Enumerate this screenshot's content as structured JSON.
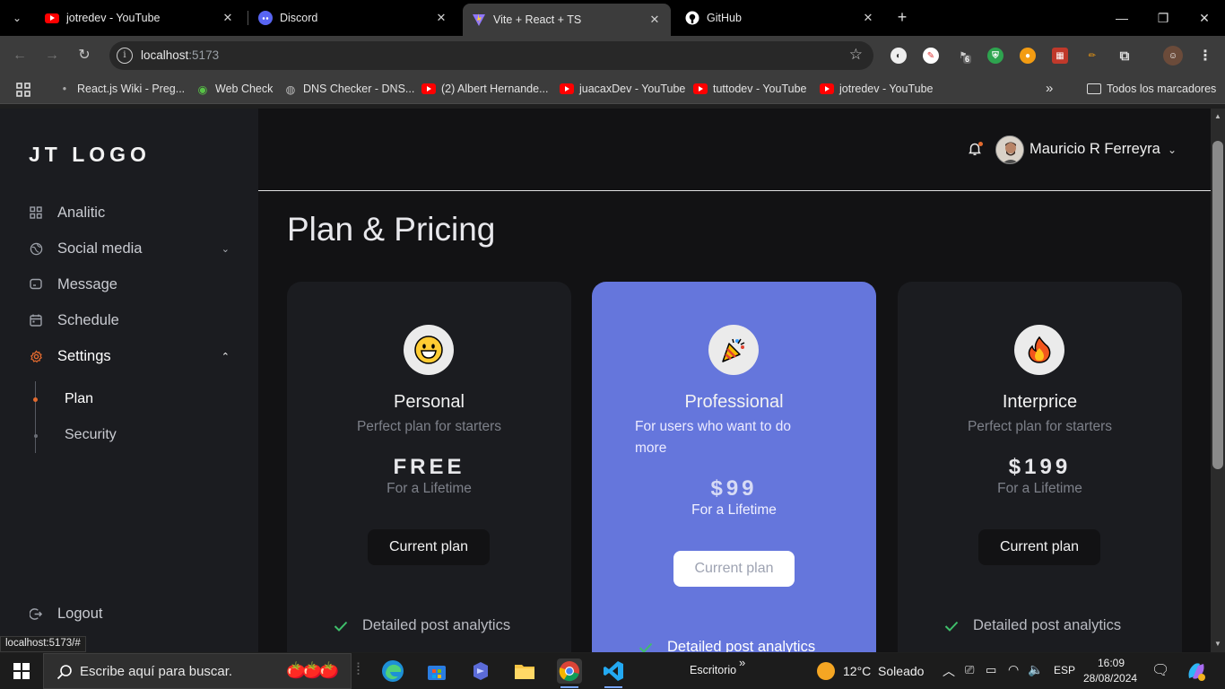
{
  "browser": {
    "tabs": [
      {
        "title": "jotredev - YouTube",
        "icon": "youtube-icon",
        "active": false
      },
      {
        "title": "Discord",
        "icon": "discord-icon",
        "active": false
      },
      {
        "title": "Vite + React + TS",
        "icon": "vite-icon",
        "active": true
      },
      {
        "title": "GitHub",
        "icon": "github-icon",
        "active": false
      }
    ],
    "address": {
      "host": "localhost",
      "port": ":5173"
    },
    "extension_badge": "6",
    "bookmarks": [
      {
        "label": "React.js Wiki - Preg...",
        "icon": "site-icon"
      },
      {
        "label": "Web Check",
        "icon": "globe-icon"
      },
      {
        "label": "DNS Checker - DNS...",
        "icon": "globe-icon"
      },
      {
        "label": "(2) Albert Hernande...",
        "icon": "youtube-icon"
      },
      {
        "label": "juacaxDev - YouTube",
        "icon": "youtube-icon"
      },
      {
        "label": "tuttodev - YouTube",
        "icon": "youtube-icon"
      },
      {
        "label": "jotredev - YouTube",
        "icon": "youtube-icon"
      }
    ],
    "all_bookmarks": "Todos los marcadores",
    "status_url": "localhost:5173/#"
  },
  "app": {
    "logo": "JT LOGO",
    "nav": [
      {
        "label": "Analitic",
        "icon": "grid-icon"
      },
      {
        "label": "Social media",
        "icon": "globe-icon",
        "has_chevron": "down"
      },
      {
        "label": "Message",
        "icon": "message-icon"
      },
      {
        "label": "Schedule",
        "icon": "calendar-icon"
      },
      {
        "label": "Settings",
        "icon": "gear-icon",
        "has_chevron": "up",
        "active": true
      }
    ],
    "settings_sub": [
      {
        "label": "Plan",
        "active": true
      },
      {
        "label": "Security",
        "active": false
      }
    ],
    "logout": "Logout",
    "user_name": "Mauricio R Ferreyra",
    "page_title": "Plan & Pricing",
    "accent": "#e36a2e",
    "highlight": "#6576dc",
    "plans": [
      {
        "emoji": "😀",
        "name": "Personal",
        "description": "Perfect plan for starters",
        "price": "FREE",
        "period": "For a Lifetime",
        "button": "Current plan",
        "feature": "Detailed post analytics"
      },
      {
        "emoji": "🎉",
        "name": "Professional",
        "description": "For users who want to do more",
        "price": "$99",
        "period": "For a Lifetime",
        "button": "Current plan",
        "feature": "Detailed post analytics"
      },
      {
        "emoji": "🔥",
        "name": "Interprice",
        "description": "Perfect plan for starters",
        "price": "$199",
        "period": "For a Lifetime",
        "button": "Current plan",
        "feature": "Detailed post analytics"
      }
    ]
  },
  "taskbar": {
    "search_placeholder": "Escribe aquí para buscar.",
    "desktop_label": "Escritorio",
    "weather": "12°C  Soleado",
    "lang": "ESP",
    "time": "16:09",
    "date": "28/08/2024"
  }
}
